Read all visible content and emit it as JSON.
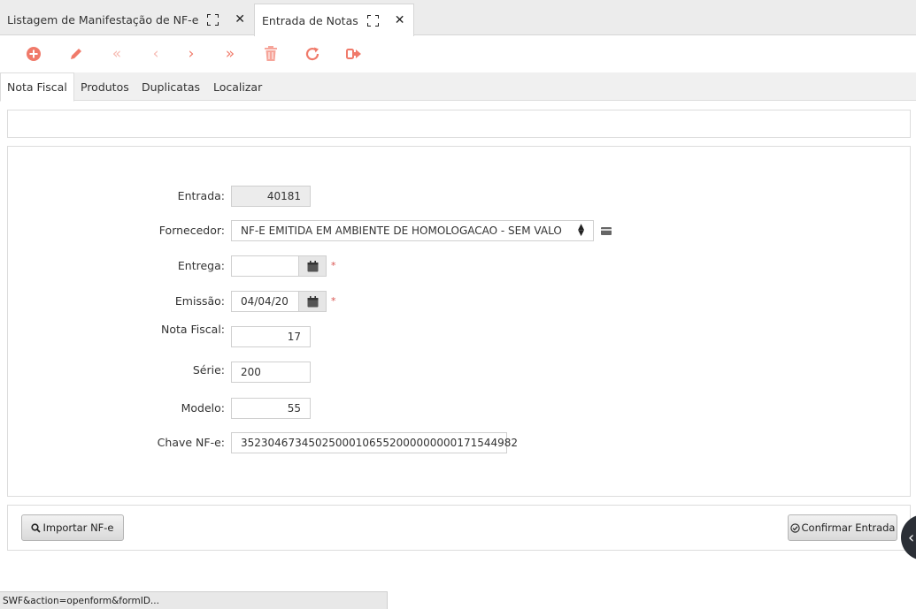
{
  "tabs": [
    {
      "label": "Listagem de Manifestação de NF-e"
    },
    {
      "label": "Entrada de Notas"
    }
  ],
  "toolbar_icons": [
    "add-icon",
    "edit-icon",
    "first-icon",
    "prev-icon",
    "next-icon",
    "last-icon",
    "delete-icon",
    "refresh-icon",
    "exit-icon"
  ],
  "subtabs": [
    {
      "label": "Nota Fiscal"
    },
    {
      "label": "Produtos"
    },
    {
      "label": "Duplicatas"
    },
    {
      "label": "Localizar"
    }
  ],
  "form": {
    "entrada": {
      "label": "Entrada:",
      "value": "40181"
    },
    "fornecedor": {
      "label": "Fornecedor:",
      "value": "NF-E EMITIDA EM AMBIENTE DE HOMOLOGACAO - SEM VALO"
    },
    "entrega": {
      "label": "Entrega:",
      "value": "",
      "required": "*"
    },
    "emissao": {
      "label": "Emissão:",
      "value": "04/04/20",
      "required": "*"
    },
    "nota_fiscal": {
      "label": "Nota Fiscal:",
      "value": "17"
    },
    "serie": {
      "label": "Série:",
      "value": "200"
    },
    "modelo": {
      "label": "Modelo:",
      "value": "55"
    },
    "chave": {
      "label": "Chave NF-e:",
      "value": "35230467345025000106552000000000171544982"
    }
  },
  "buttons": {
    "importar": "Importar NF-e",
    "confirmar": "Confirmar Entrada"
  },
  "status": "SWF&action=openform&formID..."
}
